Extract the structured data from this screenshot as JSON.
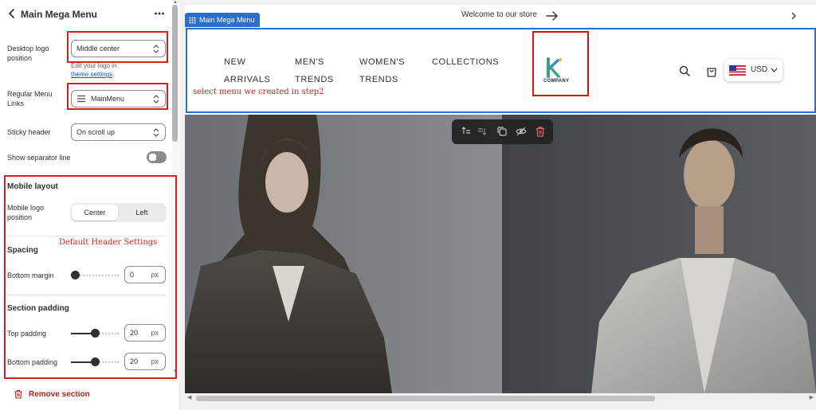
{
  "panel": {
    "title": "Main Mega Menu",
    "desktop_logo": {
      "label": "Desktop logo position",
      "value": "Middle center",
      "helper_text": "Edit your logo in",
      "helper_link": "theme settings",
      "helper_end": "."
    },
    "regular_menu": {
      "label": "Regular Menu Links",
      "value": "MainMenu"
    },
    "sticky_header": {
      "label": "Sticky header",
      "value": "On scroll up"
    },
    "separator": {
      "label": "Show separator line",
      "enabled": false
    },
    "mobile_layout": {
      "title": "Mobile layout",
      "logo_label": "Mobile logo position",
      "options": [
        "Center",
        "Left"
      ],
      "selected": "Center"
    },
    "spacing": {
      "title": "Spacing",
      "bottom_margin_label": "Bottom margin",
      "bottom_margin_value": "0",
      "bottom_margin_level": 0,
      "unit": "px"
    },
    "section_padding": {
      "title": "Section padding",
      "top_label": "Top padding",
      "top_value": "20",
      "top_level": 0.5,
      "bottom_label": "Bottom padding",
      "bottom_value": "20",
      "bottom_level": 0.5,
      "unit": "px"
    },
    "remove_label": "Remove section",
    "annotation_default": "Default Header Settings"
  },
  "preview": {
    "section_tag": "Main Mega Menu",
    "announcement": "Welcome to our store",
    "nav": {
      "new_line1": "NEW",
      "new_line2": "ARRIVALS",
      "mens_line1": "MEN'S",
      "mens_line2": "TRENDS",
      "womens_line1": "WOMEN'S",
      "womens_line2": "TRENDS",
      "collections": "COLLECTIONS"
    },
    "logo_text": "COMPANY",
    "currency": "USD",
    "annotation_menu": "select menu we created in step2"
  },
  "colors": {
    "accent_blue": "#2c6ecb",
    "annotation_red": "#e01b1b",
    "remove_red": "#b42318",
    "logo_green": "#3aa57a"
  },
  "icons": [
    "back-icon",
    "more-icon",
    "chevron-updown-icon",
    "hamburger-icon",
    "trash-icon",
    "arrow-right-icon",
    "chevron-right-icon",
    "grid-icon",
    "search-icon",
    "cart-icon",
    "us-flag-icon",
    "chevron-down-icon",
    "move-up-icon",
    "move-down-icon",
    "duplicate-icon",
    "hide-icon"
  ]
}
